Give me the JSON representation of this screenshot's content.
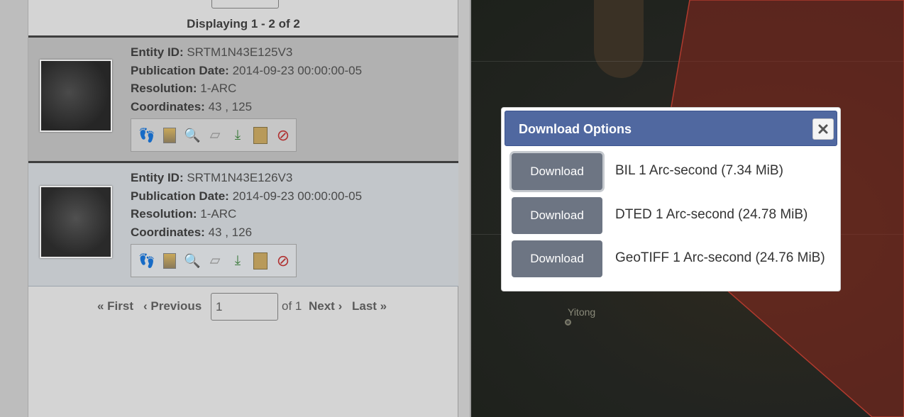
{
  "results": {
    "displaying": "Displaying 1 - 2 of 2",
    "labels": {
      "entity_id": "Entity ID:",
      "publication_date": "Publication Date:",
      "resolution": "Resolution:",
      "coordinates": "Coordinates:"
    },
    "entries": [
      {
        "entity_id": "SRTM1N43E125V3",
        "publication_date": "2014-09-23 00:00:00-05",
        "resolution": "1-ARC",
        "coordinates": "43 , 125"
      },
      {
        "entity_id": "SRTM1N43E126V3",
        "publication_date": "2014-09-23 00:00:00-05",
        "resolution": "1-ARC",
        "coordinates": "43 , 126"
      }
    ],
    "toolbar_icons": [
      "footprint-icon",
      "metadata-browse-icon",
      "zoom-overlay-icon",
      "compare-shape-icon",
      "download-icon",
      "order-icon",
      "exclude-icon"
    ]
  },
  "pager": {
    "first": "« First",
    "previous": "‹ Previous",
    "page_value": "1",
    "of": "of 1",
    "next": "Next ›",
    "last": "Last »"
  },
  "map": {
    "city_label": "Yitong"
  },
  "modal": {
    "title": "Download Options",
    "close_icon": "close-icon",
    "options": [
      {
        "button": "Download",
        "label": "BIL 1 Arc-second (7.34 MiB)"
      },
      {
        "button": "Download",
        "label": "DTED 1 Arc-second (24.78 MiB)"
      },
      {
        "button": "Download",
        "label": "GeoTIFF 1 Arc-second (24.76 MiB)"
      }
    ]
  }
}
